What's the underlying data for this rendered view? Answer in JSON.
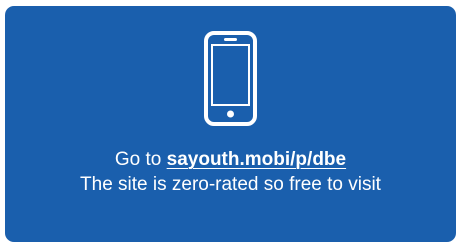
{
  "card": {
    "icon": "smartphone-icon",
    "prefix": "Go to ",
    "url_text": "sayouth.mobi/p/dbe",
    "message": "The site is zero-rated so free to visit"
  },
  "colors": {
    "card_background": "#1a5fad",
    "text": "#ffffff"
  }
}
